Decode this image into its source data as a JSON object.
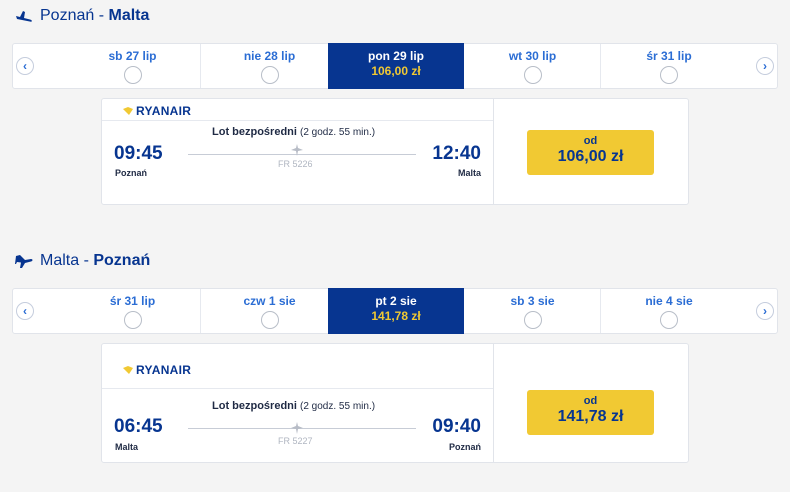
{
  "outbound": {
    "origin": "Poznań",
    "separator": " - ",
    "dest": "Malta",
    "days": [
      {
        "label": "sb 27 lip"
      },
      {
        "label": "nie 28 lip"
      },
      {
        "label": "pon 29 lip",
        "price": "106,00 zł"
      },
      {
        "label": "wt 30 lip"
      },
      {
        "label": "śr 31 lip"
      }
    ],
    "flight": {
      "carrier": "RYANAIR",
      "type": "Lot bezpośredni",
      "duration": "(2 godz. 55 min.)",
      "number": "FR 5226",
      "dep_time": "09:45",
      "dep_city": "Poznań",
      "arr_time": "12:40",
      "arr_city": "Malta",
      "from_label": "od",
      "price": "106,00 zł"
    }
  },
  "return": {
    "origin": "Malta",
    "separator": " - ",
    "dest": "Poznań",
    "days": [
      {
        "label": "śr 31 lip"
      },
      {
        "label": "czw 1 sie"
      },
      {
        "label": "pt 2 sie",
        "price": "141,78 zł"
      },
      {
        "label": "sb 3 sie"
      },
      {
        "label": "nie 4 sie"
      }
    ],
    "flight": {
      "carrier": "RYANAIR",
      "type": "Lot bezpośredni",
      "duration": "(2 godz. 55 min.)",
      "number": "FR 5227",
      "dep_time": "06:45",
      "dep_city": "Malta",
      "arr_time": "09:40",
      "arr_city": "Poznań",
      "from_label": "od",
      "price": "141,78 zł"
    }
  },
  "colors": {
    "brand_blue": "#073590",
    "accent_yellow": "#f1c933",
    "link_blue": "#2b6dd4"
  },
  "icons": {
    "outbound": "plane-takeoff-icon",
    "return": "plane-landing-icon",
    "no_flight": "no-flight-icon",
    "carrier_logo": "ryanair-harp-icon"
  }
}
